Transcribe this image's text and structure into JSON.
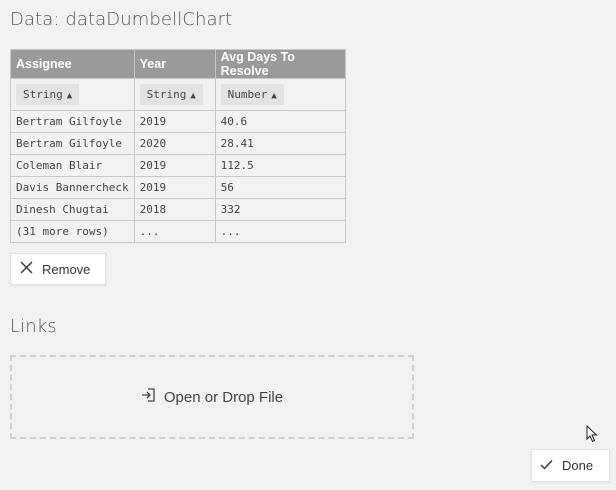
{
  "data_section": {
    "title": "Data: dataDumbellChart"
  },
  "table": {
    "columns": [
      {
        "name": "Assignee",
        "type": "String"
      },
      {
        "name": "Year",
        "type": "String"
      },
      {
        "name": "Avg Days To Resolve",
        "type": "Number"
      }
    ],
    "rows": [
      [
        "Bertram Gilfoyle",
        "2019",
        "40.6"
      ],
      [
        "Bertram Gilfoyle",
        "2020",
        "28.41"
      ],
      [
        "Coleman Blair",
        "2019",
        "112.5"
      ],
      [
        "Davis Bannercheck",
        "2019",
        "56"
      ],
      [
        "Dinesh Chugtai",
        "2018",
        "332"
      ],
      [
        "(31 more rows)",
        "...",
        "..."
      ]
    ]
  },
  "remove_button": {
    "label": "Remove",
    "icon": "close-icon"
  },
  "links_section": {
    "title": "Links"
  },
  "dropzone": {
    "label": "Open or Drop File",
    "icon": "open-file-icon"
  },
  "done_button": {
    "label": "Done",
    "icon": "check-icon"
  },
  "colors": {
    "background": "#f2f2f2",
    "header_bg": "#9a9a9a",
    "border": "#c8c8c8"
  }
}
